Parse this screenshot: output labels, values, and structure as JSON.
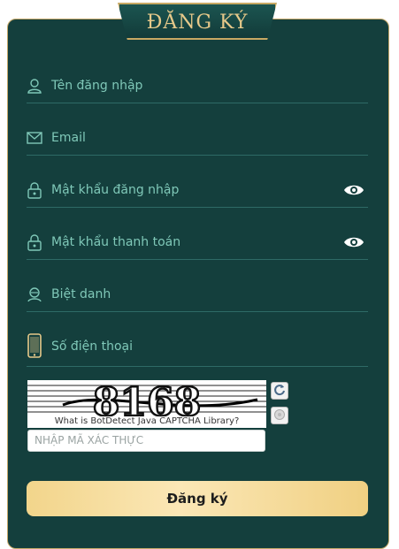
{
  "title": "ĐĂNG KÝ",
  "fields": [
    {
      "icon": "user-icon",
      "placeholder": "Tên đăng nhập"
    },
    {
      "icon": "mail-icon",
      "placeholder": "Email"
    },
    {
      "icon": "lock-icon",
      "placeholder": "Mật khẩu đăng nhập"
    },
    {
      "icon": "lock-icon",
      "placeholder": "Mật khẩu thanh toán"
    },
    {
      "icon": "nickname-icon",
      "placeholder": "Biệt danh"
    },
    {
      "icon": "phone-icon",
      "placeholder": "Số điện thoại"
    }
  ],
  "captcha": {
    "code": "8168",
    "caption": "What is BotDetect Java CAPTCHA Library?",
    "input_placeholder": "NHẬP MÃ XÁC THỰC"
  },
  "submit_label": "Đăng ký",
  "colors": {
    "panel": "#143f3d",
    "gold": "#c8a963",
    "label": "#7fc8b8"
  }
}
